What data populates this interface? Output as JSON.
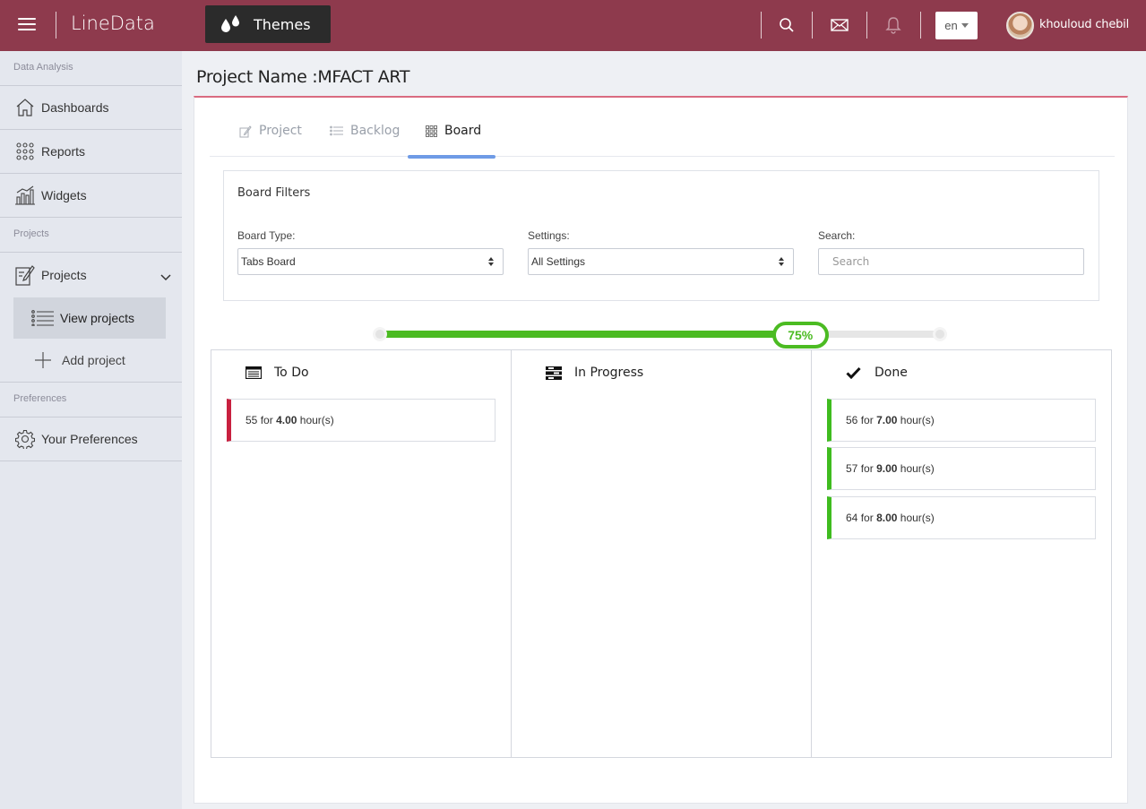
{
  "app": {
    "brand": "LineData",
    "themes_label": "Themes"
  },
  "header": {
    "lang": "en",
    "username": "khouloud chebil"
  },
  "sidebar": {
    "sections": [
      "Data Analysis",
      "Projects",
      "Preferences"
    ],
    "items": [
      {
        "label": "Dashboards",
        "icon": "home-icon"
      },
      {
        "label": "Reports",
        "icon": "grid-dots-icon"
      },
      {
        "label": "Widgets",
        "icon": "bar-chart-icon"
      },
      {
        "label": "Projects",
        "icon": "edit-document-icon"
      },
      {
        "label": "View projects",
        "icon": "list-icon"
      },
      {
        "label": "Add project",
        "icon": "plus-icon"
      },
      {
        "label": "Your Preferences",
        "icon": "gear-icon"
      }
    ]
  },
  "page": {
    "title": "Project Name :MFACT ART"
  },
  "tabs": [
    {
      "label": "Project"
    },
    {
      "label": "Backlog"
    },
    {
      "label": "Board"
    }
  ],
  "filters": {
    "title": "Board Filters",
    "board_type_label": "Board Type:",
    "board_type_value": "Tabs Board",
    "settings_label": "Settings:",
    "settings_value": "All Settings",
    "search_label": "Search:",
    "search_placeholder": "Search"
  },
  "progress": {
    "value": 0.75,
    "label": "75%"
  },
  "columns": [
    {
      "title": "To Do",
      "cards": [
        {
          "id": "55",
          "for": "for",
          "hours": "4.00",
          "unit": "hour(s)"
        }
      ]
    },
    {
      "title": "In Progress",
      "cards": []
    },
    {
      "title": "Done",
      "cards": [
        {
          "id": "56",
          "for": "for",
          "hours": "7.00",
          "unit": "hour(s)"
        },
        {
          "id": "57",
          "for": "for",
          "hours": "9.00",
          "unit": "hour(s)"
        },
        {
          "id": "64",
          "for": "for",
          "hours": "8.00",
          "unit": "hour(s)"
        }
      ]
    }
  ],
  "colors": {
    "topbar": "#8e3a4d",
    "accent_line": "#d96b80",
    "progress": "#4bbb22",
    "todo": "#c8203f",
    "done": "#3fbc1f",
    "tab_active": "#6f9be6"
  }
}
